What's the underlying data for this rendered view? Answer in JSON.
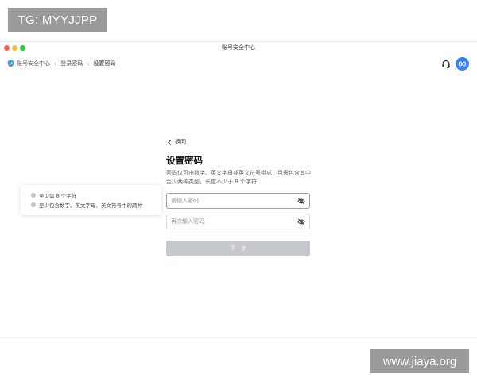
{
  "watermark": {
    "top_left": "TG: MYYJJPP",
    "bottom_right": "www.jiaya.org"
  },
  "window": {
    "title": "账号安全中心"
  },
  "breadcrumb": {
    "items": [
      "账号安全中心",
      "登录密码",
      "设置密码"
    ]
  },
  "header_icons": [
    "headset-icon",
    "avatar"
  ],
  "form": {
    "back_label": "返回",
    "title": "设置密码",
    "description": "密码仅可由数字、英文字母或英文符号组成，且需包含其中至少两种类型，长度不少于 8 个字符",
    "password_placeholder": "请输入密码",
    "confirm_placeholder": "再次输入密码",
    "next_label": "下一步"
  },
  "rules_tooltip": {
    "rules": [
      "至少需 8 个字符",
      "至少包含数字、英文字母、英文符号中的两种"
    ]
  },
  "colors": {
    "accent": "#3b82f6",
    "disabled_button": "#c5c8cc",
    "traffic_red": "#fe5f57",
    "traffic_yellow": "#febc2e",
    "traffic_green": "#28c840"
  }
}
